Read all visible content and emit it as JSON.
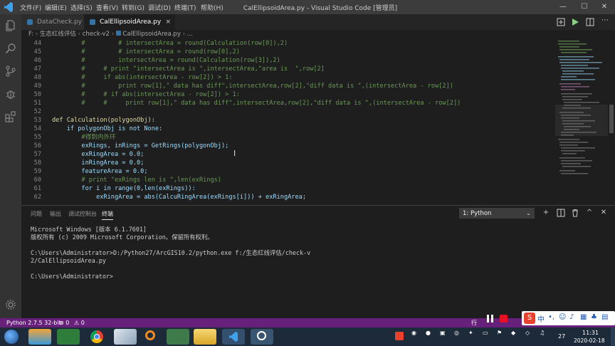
{
  "titlebar": {
    "menu": [
      "文件(F)",
      "编辑(E)",
      "选择(S)",
      "查看(V)",
      "转到(G)",
      "调试(D)",
      "终端(T)",
      "帮助(H)"
    ],
    "title": "CalEllipsoidArea.py - Visual Studio Code [管理员]",
    "min": "—",
    "max": "☐",
    "close": "✕"
  },
  "tabs": [
    {
      "label": "DataCheck.py"
    },
    {
      "label": "CalEllipsoidArea.py",
      "close": "×"
    }
  ],
  "breadcrumb": [
    "F:",
    "生态红线评估",
    "check-v2",
    "CalEllipsoidArea.py",
    "..."
  ],
  "editor": {
    "lines": [
      {
        "n": "44",
        "t": "        #         # intersectArea = round(Calculation(row[0]),2)"
      },
      {
        "n": "45",
        "t": "        #         # intersectArea = round(row[0],2)"
      },
      {
        "n": "46",
        "t": "        #         intersectArea = round(Calculation(row[3]),2)"
      },
      {
        "n": "47",
        "t": "        #     # print \"intersectArea is \",intersectArea,\"area is  \",row[2]"
      },
      {
        "n": "48",
        "t": "        #     if abs(intersectArea - row[2]) > 1:"
      },
      {
        "n": "49",
        "t": "        #         print row[1],\" data has diff\",intersectArea,row[2],\"diff data is \",(intersectArea - row[2])"
      },
      {
        "n": "50",
        "t": "        #     # if abs(intersectArea - row[2]) > 1:"
      },
      {
        "n": "51",
        "t": "        #     #     print row[1],\" data has diff\",intersectArea,row[2],\"diff data is \",(intersectArea - row[2])"
      },
      {
        "n": "52",
        "t": ""
      },
      {
        "n": "53",
        "t": "def Calculation(polygonObj):"
      },
      {
        "n": "54",
        "t": "    if polygonObj is not None:"
      },
      {
        "n": "55",
        "t": "        #得到内外环"
      },
      {
        "n": "56",
        "t": "        exRings, inRings = GetRings(polygonObj);"
      },
      {
        "n": "57",
        "t": "        exRingArea = 0.0;"
      },
      {
        "n": "58",
        "t": "        inRingArea = 0.0;"
      },
      {
        "n": "59",
        "t": "        featureArea = 0.0;"
      },
      {
        "n": "60",
        "t": "        # print \"exRings len is \",len(exRings)"
      },
      {
        "n": "61",
        "t": "        for i in range(0,len(exRings)):"
      },
      {
        "n": "62",
        "t": "            exRingArea = abs(CalcuRingArea(exRings[i])) + exRingArea;"
      }
    ]
  },
  "panel": {
    "tabs": [
      "问题",
      "输出",
      "调试控制台",
      "终端"
    ],
    "terminal_select": "1: Python",
    "icons": [
      "plus-icon",
      "split-icon",
      "trash-icon",
      "chevron-up-icon",
      "close-icon"
    ],
    "terminal_lines": [
      "Microsoft Windows [版本 6.1.7601]",
      "版权所有 (c) 2009 Microsoft Corporation。保留所有权利。",
      "",
      "C:\\Users\\Administrator>D:/Python27/ArcGIS10.2/python.exe f:/生态红线评估/check-v",
      "2/CalEllipsoidArea.py",
      "",
      "C:\\Users\\Administrator>"
    ]
  },
  "statusbar": {
    "python": "Python 2.7.5 32-bit",
    "errors": "⊗ 0",
    "warnings": "⚠ 0",
    "right": "行"
  },
  "taskbar": {
    "time": "11:31",
    "date": "2020-02-18",
    "badge": "27"
  },
  "colors": {
    "statusbar": "#68217a",
    "editor_bg": "#1e1e1e",
    "activitybar": "#333333",
    "taskbar": "#1c2a3a"
  }
}
